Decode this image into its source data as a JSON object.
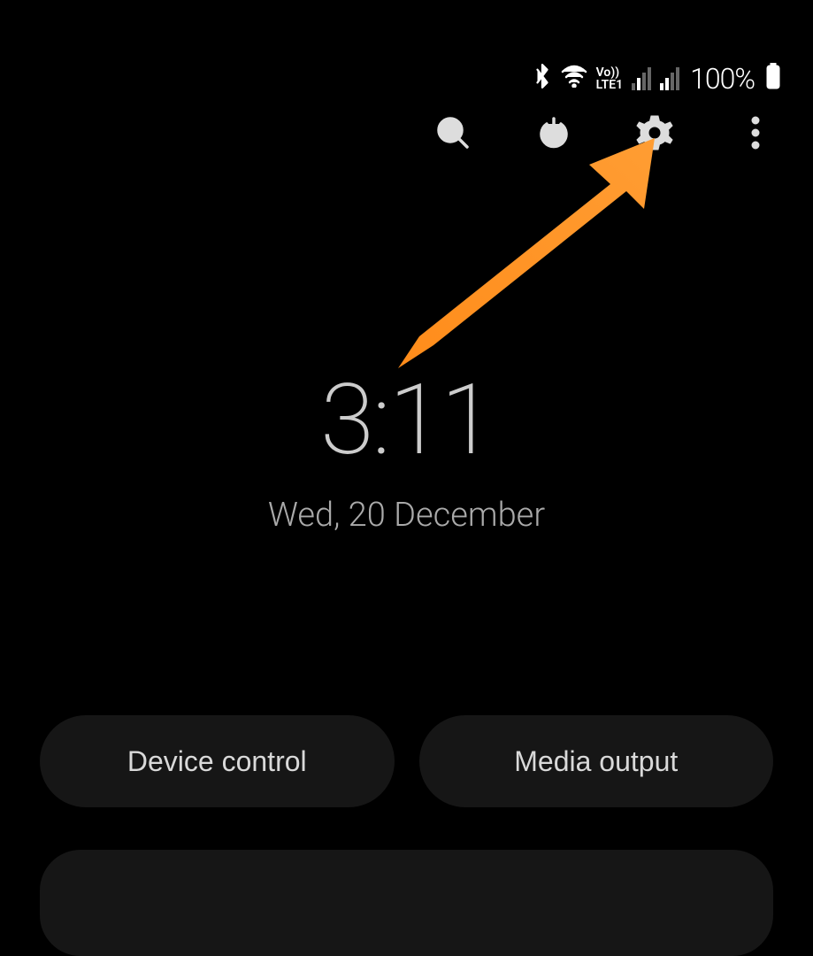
{
  "status_bar": {
    "network_label": "Vo))\nLTE1",
    "battery_text": "100%"
  },
  "toolbar": {
    "search_name": "search",
    "power_name": "power",
    "settings_name": "settings",
    "more_name": "more"
  },
  "clock": {
    "time": "3:11",
    "date": "Wed, 20 December"
  },
  "buttons": {
    "device_control": "Device control",
    "media_output": "Media output"
  }
}
